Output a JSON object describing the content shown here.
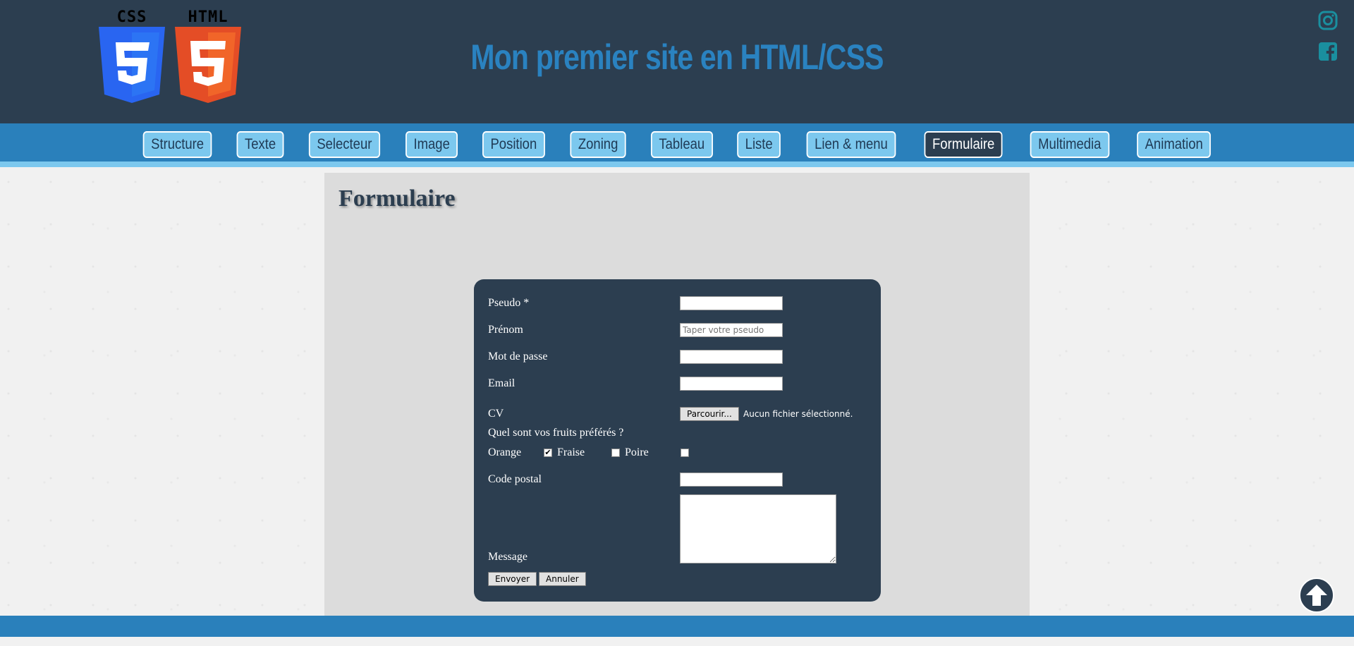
{
  "header": {
    "logos": [
      {
        "label": "CSS",
        "icon": "css3-logo-icon",
        "color": "#2965f1"
      },
      {
        "label": "HTML",
        "icon": "html5-logo-icon",
        "color": "#e44d26"
      }
    ],
    "title": "Mon premier site en HTML/CSS",
    "social": [
      {
        "icon": "instagram-icon"
      },
      {
        "icon": "facebook-icon"
      }
    ]
  },
  "nav": {
    "items": [
      {
        "label": "Structure"
      },
      {
        "label": "Texte"
      },
      {
        "label": "Selecteur"
      },
      {
        "label": "Image"
      },
      {
        "label": "Position"
      },
      {
        "label": "Zoning"
      },
      {
        "label": "Tableau"
      },
      {
        "label": "Liste"
      },
      {
        "label": "Lien & menu"
      },
      {
        "label": "Formulaire",
        "active": true
      },
      {
        "label": "Multimedia"
      },
      {
        "label": "Animation"
      }
    ]
  },
  "main": {
    "title": "Formulaire"
  },
  "form": {
    "pseudo_label": "Pseudo *",
    "pseudo_value": "",
    "prenom_label": "Prénom",
    "prenom_placeholder": "Taper votre pseudo",
    "password_label": "Mot de passe",
    "email_label": "Email",
    "cv_label": "CV",
    "file_button": "Parcourir...",
    "file_status": "Aucun fichier sélectionné.",
    "fruits_question": "Quel sont vos fruits préférés ?",
    "fruits": [
      {
        "label": "Orange",
        "checked": true
      },
      {
        "label": "Fraise",
        "checked": false
      },
      {
        "label": "Poire",
        "checked": false
      }
    ],
    "postal_label": "Code postal",
    "message_label": "Message",
    "submit_label": "Envoyer",
    "cancel_label": "Annuler"
  },
  "footer": {
    "back_to_top_icon": "arrow-up-circle-icon"
  },
  "colors": {
    "header_bg": "#2c3e50",
    "nav_bg": "#2a80bb",
    "nav_item_bg": "#7cc8ee",
    "accent_title": "#2a82c0",
    "social_icon": "#1a8f9f"
  }
}
